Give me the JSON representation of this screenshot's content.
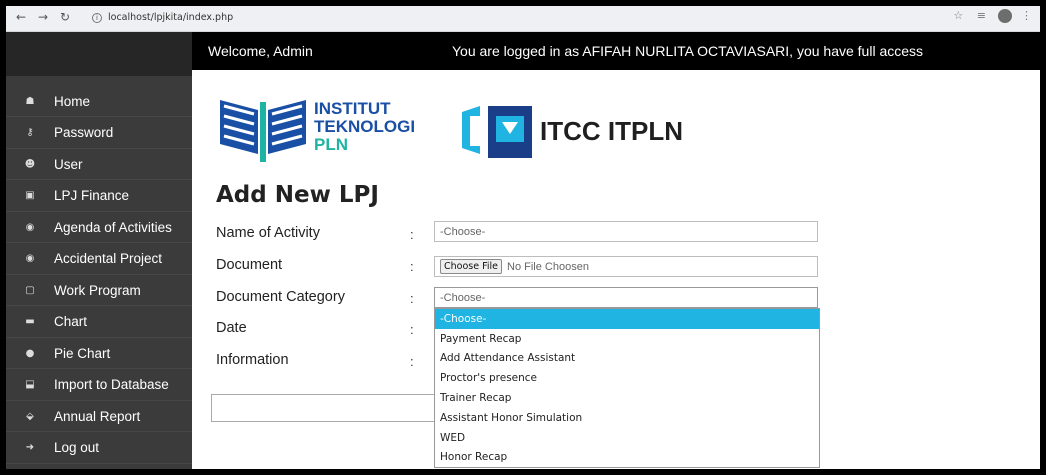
{
  "browser": {
    "url": "localhost/lpjkita/index.php",
    "back_icon": "back-arrow-icon",
    "forward_icon": "forward-arrow-icon",
    "reload_icon": "reload-icon",
    "star_icon": "star-icon"
  },
  "header": {
    "welcome": "Welcome, Admin",
    "logged_in": "You are logged in as AFIFAH  NURLITA OCTAVIASARI, you have full access"
  },
  "sidebar": {
    "items": [
      {
        "label": "Home",
        "icon": "home-icon"
      },
      {
        "label": "Password",
        "icon": "key-icon"
      },
      {
        "label": "User",
        "icon": "users-icon"
      },
      {
        "label": "LPJ Finance",
        "icon": "finance-icon"
      },
      {
        "label": "Agenda of Activities",
        "icon": "eye-icon"
      },
      {
        "label": "Accidental Project",
        "icon": "eye-icon"
      },
      {
        "label": "Work Program",
        "icon": "square-icon"
      },
      {
        "label": "Chart",
        "icon": "chart-icon"
      },
      {
        "label": "Pie Chart",
        "icon": "pie-chart-icon"
      },
      {
        "label": "Import to Database",
        "icon": "import-icon"
      },
      {
        "label": "Annual Report",
        "icon": "report-icon"
      },
      {
        "label": "Log out",
        "icon": "logout-icon"
      }
    ]
  },
  "logos": {
    "institut": {
      "line1": "INSTITUT",
      "line2": "TEKNOLOGI",
      "line3": "PLN"
    },
    "itcc": "ITCC ITPLN"
  },
  "form": {
    "title": "Add New LPJ",
    "name_of_activity": {
      "label": "Name of Activity",
      "value": "-Choose-"
    },
    "document": {
      "label": "Document",
      "button": "Choose File",
      "value": "No File Choosen"
    },
    "document_category": {
      "label": "Document Category",
      "value": "-Choose-"
    },
    "date": {
      "label": "Date"
    },
    "information": {
      "label": "Information"
    },
    "colon": ":"
  },
  "dropdown": {
    "options": [
      "-Choose-",
      "Payment Recap",
      "Add Attendance Assistant",
      "Proctor's presence",
      "Trainer Recap",
      "Assistant Honor Simulation",
      "WED",
      "Honor Recap"
    ],
    "selected_index": 0,
    "highlight_color": "#1fb4e2"
  }
}
